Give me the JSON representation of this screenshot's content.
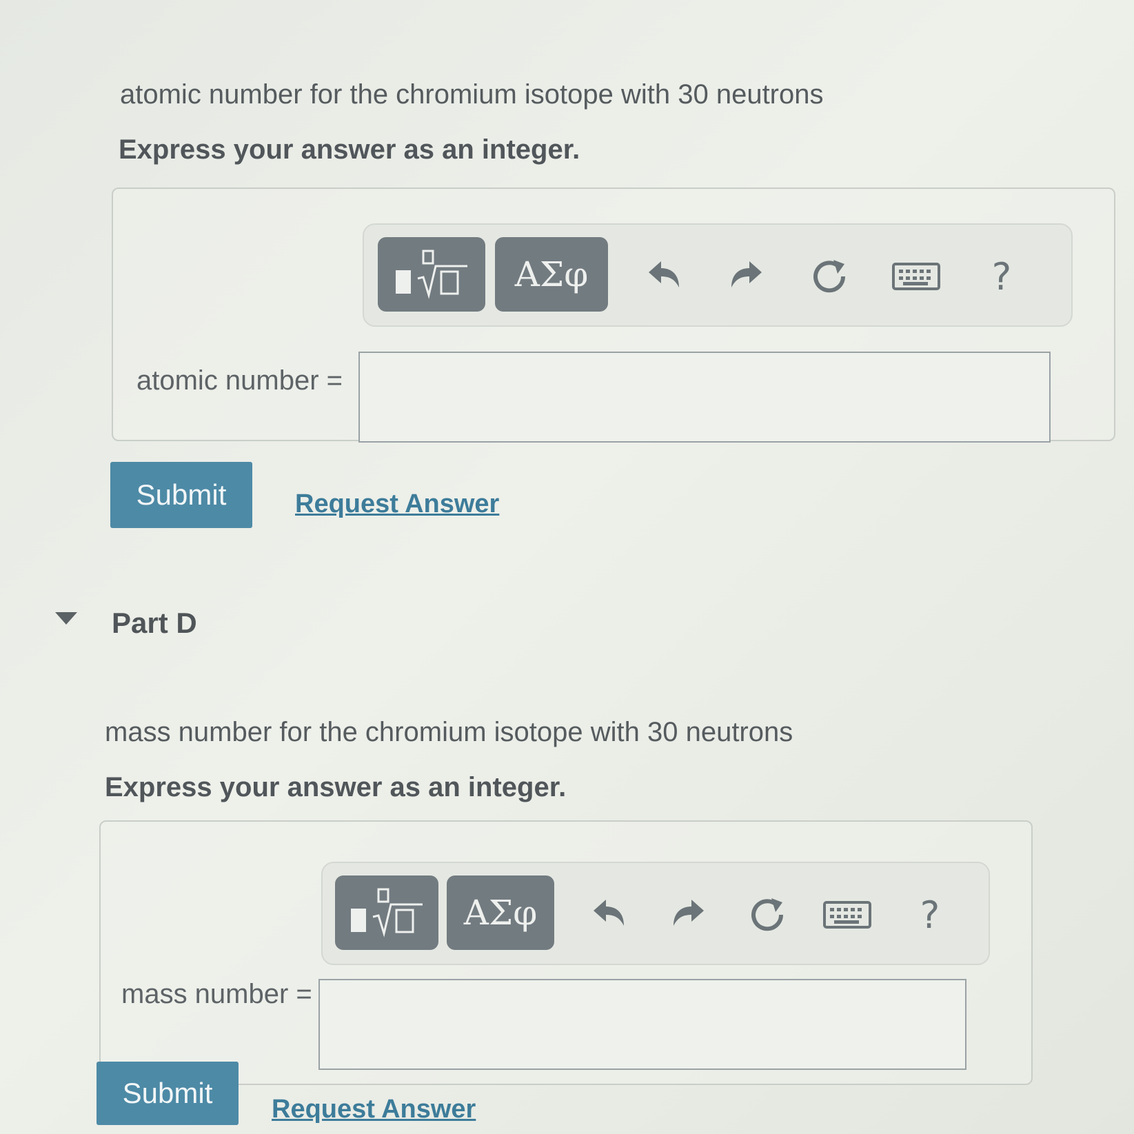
{
  "part_c": {
    "prompt": "atomic number for the chromium isotope with 30 neutrons",
    "instruction": "Express your answer as an integer.",
    "toolbar": {
      "templates_icon": "fraction-sqrt-template-icon",
      "greek_label": "ΑΣφ",
      "undo_icon": "undo-icon",
      "redo_icon": "redo-icon",
      "reset_icon": "reset-icon",
      "keyboard_icon": "keyboard-icon",
      "help_label": "?"
    },
    "field_label": "atomic number =",
    "field_value": "",
    "submit_label": "Submit",
    "request_label": "Request Answer"
  },
  "part_d": {
    "title": "Part D",
    "prompt": "mass number for the chromium isotope with 30 neutrons",
    "instruction": "Express your answer as an integer.",
    "toolbar": {
      "templates_icon": "fraction-sqrt-template-icon",
      "greek_label": "ΑΣφ",
      "undo_icon": "undo-icon",
      "redo_icon": "redo-icon",
      "reset_icon": "reset-icon",
      "keyboard_icon": "keyboard-icon",
      "help_label": "?"
    },
    "field_label": "mass number =",
    "field_value": "",
    "submit_label": "Submit",
    "request_label": "Request Answer"
  },
  "colors": {
    "submit": "#4d8aa6",
    "link": "#3d7c9a",
    "toolbar_button": "#727b80"
  }
}
